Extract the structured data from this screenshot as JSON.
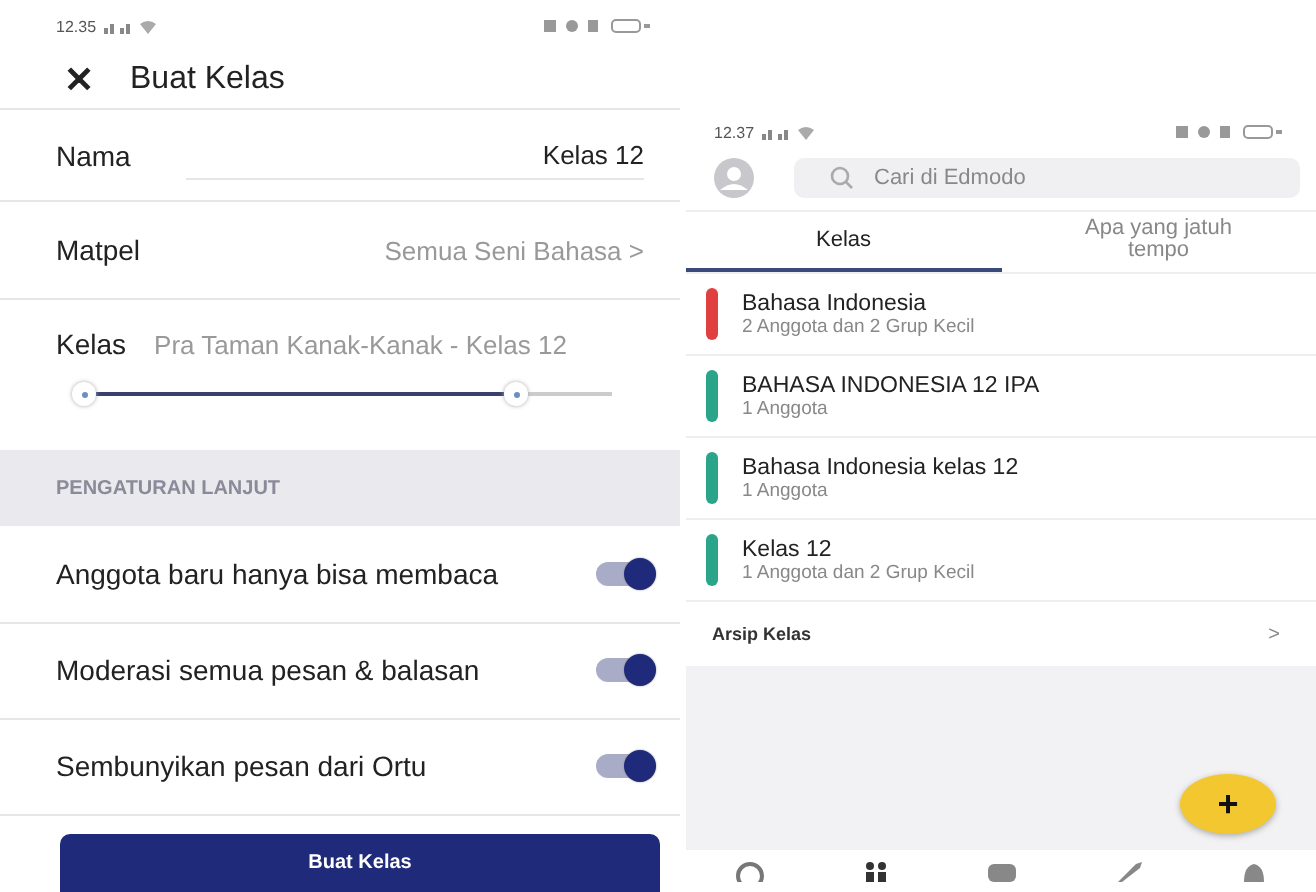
{
  "left_screen": {
    "status_bar": {
      "time": "12.35"
    },
    "header": {
      "close": "✕",
      "title": "Buat Kelas"
    },
    "fields": [
      {
        "kind": "input",
        "label": "Nama",
        "value": "Kelas 12"
      },
      {
        "kind": "select",
        "label": "Matpel",
        "value": "Semua Seni Bahasa",
        "chevron": ">"
      },
      {
        "kind": "range",
        "label": "Kelas",
        "value": "Pra Taman Kanak-Kanak - Kelas 12",
        "thumbs": [
          {
            "level": 0
          },
          {
            "level": 0.82
          }
        ]
      }
    ],
    "section_header": "PENGATURAN LANJUT",
    "toggles": [
      {
        "label": "Anggota baru hanya bisa membaca",
        "on": true
      },
      {
        "label": "Moderasi semua pesan & balasan",
        "on": true
      },
      {
        "label": "Sembunyikan pesan dari Ortu",
        "on": true
      }
    ],
    "submit_button": "Buat Kelas"
  },
  "right_screen": {
    "status_bar": {
      "time": "12.37"
    },
    "search": {
      "placeholder": "Cari di Edmodo"
    },
    "tabs": [
      {
        "label": "Kelas",
        "selected": true
      },
      {
        "label": "Apa yang jatuh tempo",
        "selected": false
      }
    ],
    "classes": [
      {
        "name": "Bahasa Indonesia",
        "members": "2 Anggota dan 2 Grup Kecil",
        "color": "#e04040"
      },
      {
        "name": "BAHASA INDONESIA 12 IPA",
        "members": "1 Anggota",
        "color": "#2aa58a"
      },
      {
        "name": "Bahasa Indonesia kelas 12",
        "members": "1 Anggota",
        "color": "#2aa58a"
      },
      {
        "name": "Kelas 12",
        "members": "1 Anggota dan 2 Grup Kecil",
        "color": "#2aa58a"
      }
    ],
    "archive": {
      "label": "Arsip Kelas",
      "chevron": ">"
    },
    "fab": "+"
  }
}
